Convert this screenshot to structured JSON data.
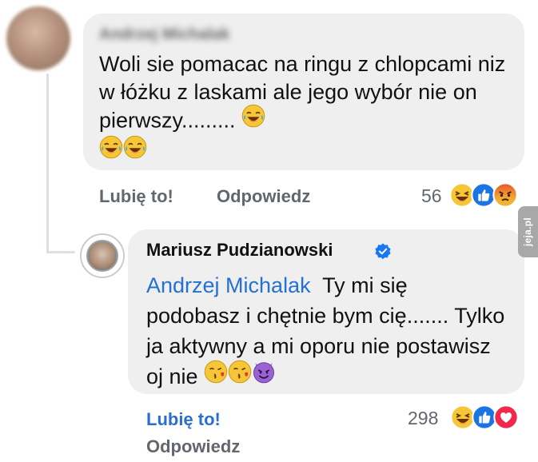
{
  "comment_1": {
    "author": "Andrzej Michalak",
    "text": "Woli sie pomacac na ringu z chlopcami niz w łóżku z laskami ale jego wybór nie on pierwszy.........",
    "actions": {
      "like": "Lubię to!",
      "reply": "Odpowiedz"
    },
    "reaction_count": "56",
    "reactions": [
      "haha-icon",
      "like-icon",
      "angry-icon"
    ]
  },
  "comment_2": {
    "author": "Mariusz Pudzianowski",
    "verified": true,
    "mention": "Andrzej Michalak",
    "text": "Ty mi się podobasz i chętnie bym cię....... Tylko ja aktywny a mi oporu nie postawisz  oj nie",
    "actions": {
      "like": "Lubię to!",
      "reply": "Odpowiedz"
    },
    "like_active": true,
    "reaction_count": "298",
    "reactions": [
      "haha-icon",
      "like-icon",
      "love-icon"
    ]
  },
  "watermark": {
    "text": "jeja.pl"
  },
  "colors": {
    "bubble": "#efefef",
    "link_blue": "#2571d0",
    "action_gray": "#62676d",
    "verified_blue": "#1877f2"
  }
}
